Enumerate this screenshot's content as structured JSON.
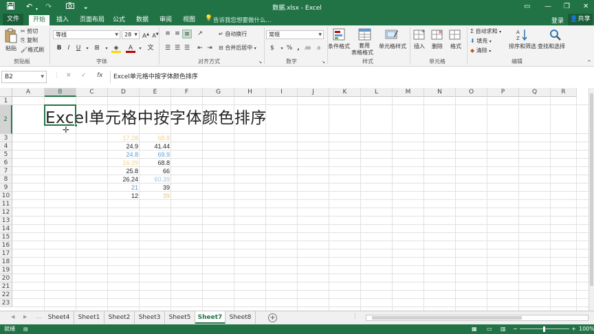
{
  "titlebar": {
    "title": "数据.xlsx - Excel",
    "bg_color": "#217346"
  },
  "tabs": {
    "file": "文件",
    "items": [
      "开始",
      "插入",
      "页面布局",
      "公式",
      "数据",
      "审阅",
      "视图"
    ],
    "active": "开始",
    "tellme": "告诉我您想要做什么...",
    "login": "登录",
    "share": "共享"
  },
  "ribbon": {
    "clipboard": {
      "paste": "粘贴",
      "cut": "剪切",
      "copy": "复制",
      "format_painter": "格式刷",
      "label": "剪贴板"
    },
    "font": {
      "name": "等线",
      "size": "28",
      "label": "字体"
    },
    "alignment": {
      "wrap": "自动换行",
      "merge": "合并后居中",
      "label": "对齐方式"
    },
    "number": {
      "format": "常规",
      "label": "数字"
    },
    "styles": {
      "conditional": "条件格式",
      "table_line1": "套用",
      "table_line2": "表格格式",
      "cell_styles": "单元格样式",
      "label": "样式"
    },
    "cells": {
      "insert": "插入",
      "delete": "删除",
      "format": "格式",
      "label": "单元格"
    },
    "editing": {
      "autosum": "自动求和",
      "fill": "填充",
      "clear": "清除",
      "sort": "排序和筛选",
      "find": "查找和选择",
      "label": "编辑"
    }
  },
  "formula_bar": {
    "name_box": "B2",
    "content": "Excel单元格中按字体颜色排序"
  },
  "columns": [
    "A",
    "B",
    "C",
    "D",
    "E",
    "F",
    "G",
    "H",
    "I",
    "J",
    "K",
    "L",
    "M",
    "N",
    "O",
    "P",
    "Q",
    "R"
  ],
  "selected_column": "B",
  "rows": [
    "1",
    "2",
    "3",
    "4",
    "5",
    "6",
    "7",
    "8",
    "9",
    "10",
    "11",
    "12",
    "13",
    "14",
    "15",
    "16",
    "17",
    "18",
    "19",
    "20",
    "21",
    "22",
    "23"
  ],
  "selected_row": "2",
  "sheet_title": "Excel单元格中按字体颜色排序",
  "cells": {
    "d": [
      {
        "v": "17.28",
        "color": "#f5d08a"
      },
      {
        "v": "24.9",
        "color": "#222222"
      },
      {
        "v": "24.8",
        "color": "#5b9bd5"
      },
      {
        "v": "16.29",
        "color": "#f5d08a"
      },
      {
        "v": "25.8",
        "color": "#222222"
      },
      {
        "v": "26.24",
        "color": "#222222"
      },
      {
        "v": "21",
        "color": "#5b9bd5"
      },
      {
        "v": "12",
        "color": "#222222"
      }
    ],
    "e": [
      {
        "v": "68.8",
        "color": "#f5d08a"
      },
      {
        "v": "41.44",
        "color": "#222222"
      },
      {
        "v": "69.9",
        "color": "#5b9bd5"
      },
      {
        "v": "68.8",
        "color": "#222222"
      },
      {
        "v": "66",
        "color": "#222222"
      },
      {
        "v": "60.39",
        "color": "#9bc2e6"
      },
      {
        "v": "39",
        "color": "#222222"
      },
      {
        "v": "39",
        "color": "#f5c060"
      }
    ]
  },
  "sheets": [
    "Sheet4",
    "Sheet1",
    "Sheet2",
    "Sheet3",
    "Sheet5",
    "Sheet7",
    "Sheet8"
  ],
  "active_sheet": "Sheet7",
  "status": {
    "zoom": "100%"
  }
}
